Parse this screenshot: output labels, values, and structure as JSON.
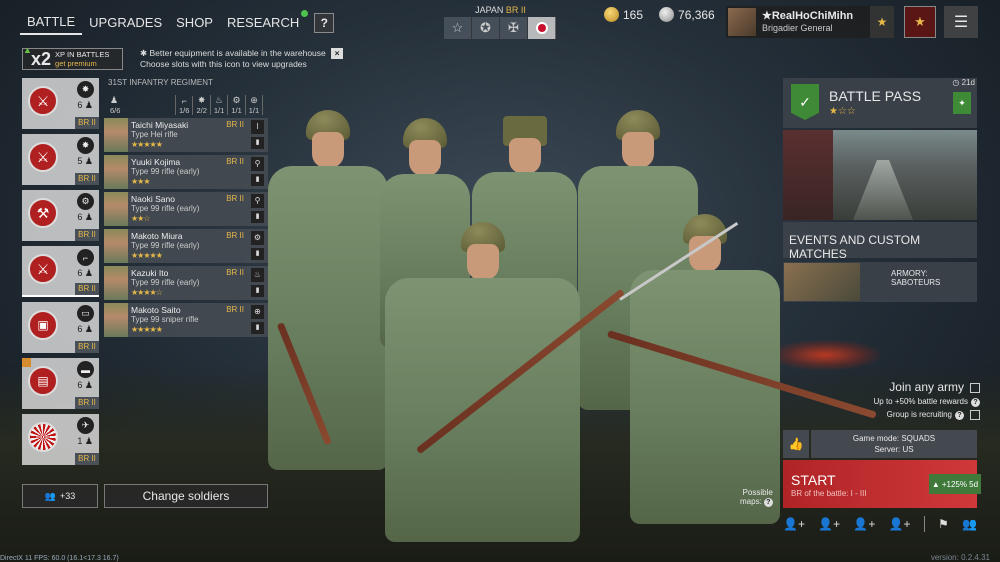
{
  "nav": {
    "tabs": [
      {
        "label": "BATTLE",
        "active": true
      },
      {
        "label": "UPGRADES"
      },
      {
        "label": "SHOP"
      },
      {
        "label": "RESEARCH",
        "notification": true
      }
    ],
    "help": "?"
  },
  "army": {
    "label": "JAPAN",
    "br": "BR II",
    "options": [
      "star-icon",
      "star-circle-icon",
      "cross-icon",
      "rising-sun-icon"
    ],
    "selected": 3
  },
  "currency": {
    "gold": "165",
    "silver": "76,366"
  },
  "profile": {
    "name": "★RealHoChiMihn",
    "rank": "Brigadier General"
  },
  "premium": {
    "multiplier": "x2",
    "text": "XP IN BATTLES",
    "link": "get premium"
  },
  "notice": {
    "line1": "Better equipment is available in the warehouse",
    "line2": "Choose slots with this icon to view upgrades"
  },
  "squads": [
    {
      "count": "6",
      "br": "BR II",
      "class": "grenade-icon",
      "emblem": "infantry-emblem",
      "selected": false
    },
    {
      "count": "5",
      "br": "BR II",
      "class": "grenade-icon",
      "emblem": "infantry-emblem",
      "selected": false
    },
    {
      "count": "6",
      "br": "BR II",
      "class": "wrench-icon",
      "emblem": "engineer-emblem",
      "selected": false
    },
    {
      "count": "6",
      "br": "BR II",
      "class": "rifle-icon",
      "emblem": "infantry-emblem",
      "selected": true
    },
    {
      "count": "6",
      "br": "BR II",
      "class": "tank-icon",
      "emblem": "tank-emblem",
      "selected": false
    },
    {
      "count": "6",
      "br": "BR II",
      "class": "truck-icon",
      "emblem": "vehicle-emblem",
      "selected": false
    },
    {
      "count": "1",
      "br": "BR II",
      "class": "plane-icon",
      "emblem": "air-emblem",
      "selected": false
    }
  ],
  "regiment": {
    "title": "31ST INFANTRY REGIMENT",
    "stats": [
      "6/6",
      "1/6",
      "2/2",
      "1/1",
      "1/1",
      "1/1"
    ]
  },
  "soldiers": [
    {
      "name": "Taichi Miyasaki",
      "weapon": "Type Hei rifle",
      "stars": "★★★★★",
      "br": "BR II"
    },
    {
      "name": "Yuuki Kojima",
      "weapon": "Type 99 rifle (early)",
      "stars": "★★★",
      "br": "BR II"
    },
    {
      "name": "Naoki Sano",
      "weapon": "Type 99 rifle (early)",
      "stars": "★★☆",
      "br": "BR II"
    },
    {
      "name": "Makoto Miura",
      "weapon": "Type 99 rifle (early)",
      "stars": "★★★★★",
      "br": "BR II"
    },
    {
      "name": "Kazuki Ito",
      "weapon": "Type 99 rifle (early)",
      "stars": "★★★★☆",
      "br": "BR II"
    },
    {
      "name": "Makoto Saito",
      "weapon": "Type 99 sniper rifle",
      "stars": "★★★★★",
      "br": "BR II"
    }
  ],
  "bottom_left": {
    "reserve": "+33",
    "change": "Change soldiers"
  },
  "battle_pass": {
    "title": "BATTLE PASS",
    "stars": "★☆☆",
    "days": "21d"
  },
  "events": {
    "title": "EVENTS AND CUSTOM MATCHES",
    "card": "ARMORY: SABOTEURS"
  },
  "join": {
    "title": "Join any army",
    "bonus": "Up to +50% battle rewards",
    "recruiting": "Group is recruiting"
  },
  "mode": {
    "line1": "Game mode: SQUADS",
    "line2": "Server: US"
  },
  "start": {
    "label": "START",
    "sub": "BR of the battle: I - III",
    "boost": "+125% 5d"
  },
  "maps": {
    "line1": "Possible",
    "line2": "maps:"
  },
  "footer": {
    "fps": "DirectX 11 FPS: 60.0 (16.1<17.3 16.7)",
    "version": "version: 0.2.4.31"
  }
}
